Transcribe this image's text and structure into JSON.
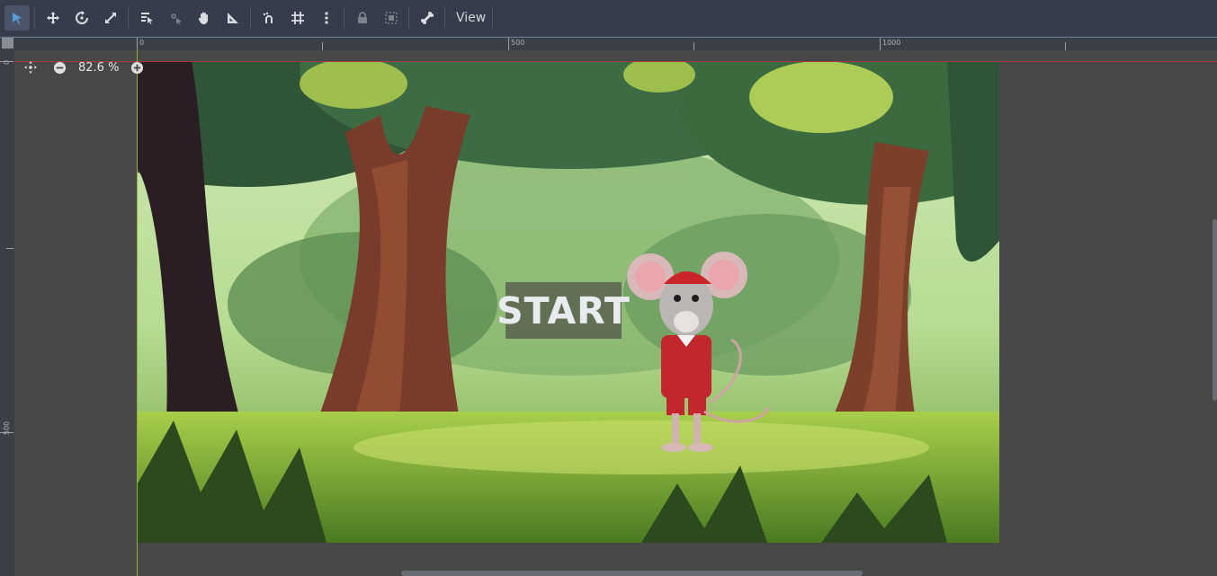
{
  "toolbar": {
    "tools": [
      {
        "name": "select-mode",
        "icon": "arrow-pointer-icon",
        "active": true
      },
      {
        "name": "move-mode",
        "icon": "move-arrows-icon"
      },
      {
        "name": "rotate-mode",
        "icon": "rotate-icon"
      },
      {
        "name": "scale-mode",
        "icon": "scale-icon"
      },
      {
        "name": "list-select",
        "icon": "list-select-icon"
      },
      {
        "name": "pivot-mode",
        "icon": "pivot-icon"
      },
      {
        "name": "pan-mode",
        "icon": "hand-icon"
      },
      {
        "name": "ruler-mode",
        "icon": "ruler-icon"
      },
      {
        "name": "smart-snap",
        "icon": "snap-icon"
      },
      {
        "name": "grid-snap",
        "icon": "grid-icon"
      },
      {
        "name": "snap-options",
        "icon": "kebab-icon"
      },
      {
        "name": "lock",
        "icon": "lock-icon"
      },
      {
        "name": "group",
        "icon": "group-icon"
      },
      {
        "name": "skeleton",
        "icon": "bone-icon"
      }
    ],
    "view_label": "View"
  },
  "ruler": {
    "top_labels": [
      "0",
      "500",
      "1000"
    ],
    "left_labels": [
      "0",
      "500"
    ]
  },
  "zoom": {
    "label": "82.6 %"
  },
  "scene": {
    "start_label": "START"
  },
  "colors": {
    "toolbar_bg": "#363d4a",
    "viewport_bg": "#484848",
    "guide_red": "#a33b45",
    "guide_green": "#8fb33a",
    "accent": "#5a9bd8"
  }
}
